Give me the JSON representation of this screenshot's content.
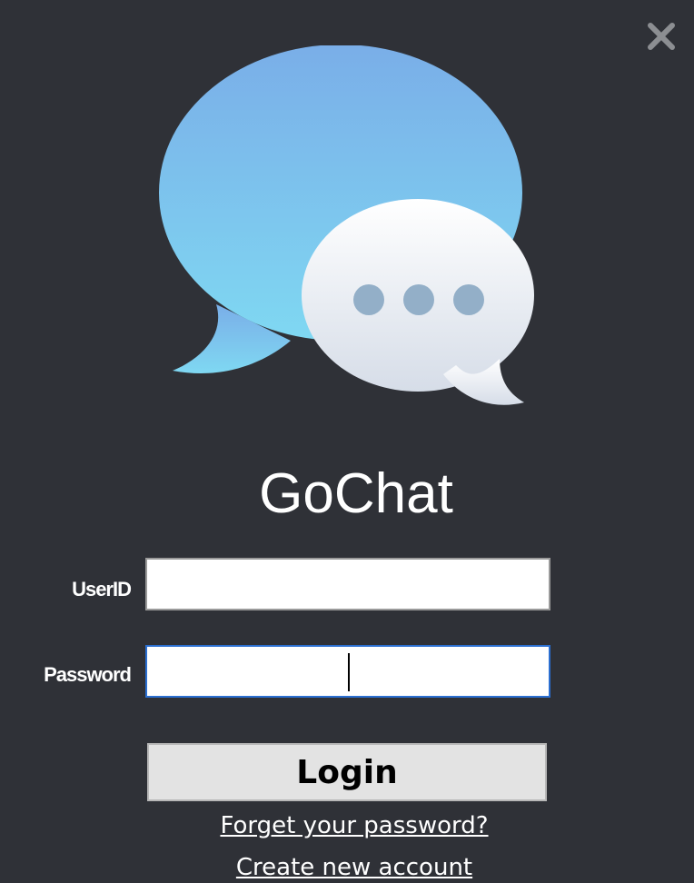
{
  "window": {
    "close_symbol": "✕"
  },
  "logo": {
    "icon": "chat-bubbles-icon",
    "colors": {
      "back_bubble_top": "#7aaee8",
      "back_bubble_bottom": "#7fd8f2",
      "front_bubble_top": "#ffffff",
      "front_bubble_bottom": "#d6dde8",
      "dots": "#93afc8"
    }
  },
  "app": {
    "title": "GoChat"
  },
  "form": {
    "userid_label": "UserID",
    "userid_value": "",
    "password_label": "Password",
    "password_value": "",
    "login_label": "Login",
    "forgot_link": "Forget your password?",
    "create_link": "Create new account"
  },
  "colors": {
    "background": "#2f3137",
    "focus_border": "#2b6fd1"
  }
}
